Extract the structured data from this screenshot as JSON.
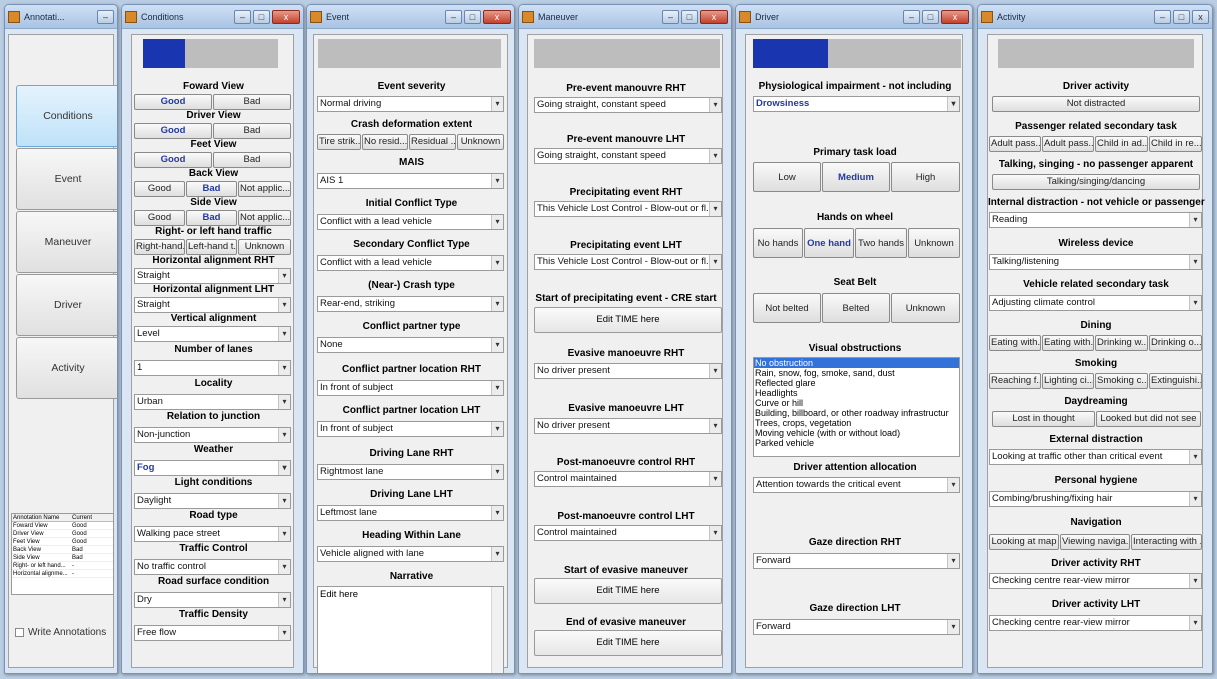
{
  "windows": {
    "annotation": {
      "title": "Annotati..."
    },
    "conditions": {
      "title": "Conditions"
    },
    "event": {
      "title": "Event"
    },
    "maneuver": {
      "title": "Maneuver"
    },
    "driver": {
      "title": "Driver"
    },
    "activity": {
      "title": "Activity"
    }
  },
  "nav": {
    "conditions": "Conditions",
    "event": "Event",
    "maneuver": "Maneuver",
    "driver": "Driver",
    "activity": "Activity"
  },
  "annotation_table": {
    "headers": [
      "Annotation Name",
      "Current"
    ],
    "rows": [
      [
        "Foward View",
        "Good"
      ],
      [
        "Driver View",
        "Good"
      ],
      [
        "Feet View",
        "Good"
      ],
      [
        "Back View",
        "Bad"
      ],
      [
        "Side View",
        "Bad"
      ],
      [
        "Right- or left hand...",
        "-"
      ],
      [
        "Horizontal alignme...",
        "-"
      ]
    ]
  },
  "write_annotations": "Write Annotations",
  "progress": {
    "conditions": 0.31,
    "event": 0,
    "maneuver": 0,
    "driver": 0.36,
    "activity": 0
  },
  "conditions": {
    "foward_view": "Foward View",
    "driver_view": "Driver View",
    "feet_view": "Feet View",
    "back_view": "Back View",
    "side_view": "Side View",
    "good": "Good",
    "bad": "Bad",
    "not_applic": "Not applic...",
    "traffic_hand": "Right- or left hand traffic",
    "right_hand": "Right-hand...",
    "left_hand": "Left-hand t...",
    "unknown": "Unknown",
    "h_align_rht": "Horizontal alignment RHT",
    "h_align_rht_val": "Straight",
    "h_align_lht": "Horizontal alignment LHT",
    "h_align_lht_val": "Straight",
    "v_align": "Vertical alignment",
    "v_align_val": "Level",
    "lanes": "Number of lanes",
    "lanes_val": "1",
    "locality": "Locality",
    "locality_val": "Urban",
    "junction": "Relation to junction",
    "junction_val": "Non-junction",
    "weather": "Weather",
    "weather_val": "Fog",
    "light": "Light conditions",
    "light_val": "Daylight",
    "road_type": "Road type",
    "road_type_val": "Walking pace street",
    "traffic_control": "Traffic Control",
    "traffic_control_val": "No traffic control",
    "surface": "Road surface condition",
    "surface_val": "Dry",
    "density": "Traffic Density",
    "density_val": "Free flow"
  },
  "event": {
    "severity": "Event severity",
    "severity_val": "Normal driving",
    "crash_def": "Crash deformation extent",
    "tire": "Tire strik...",
    "no_resid": "No resid...",
    "residual": "Residual ...",
    "unknown": "Unknown",
    "mais": "MAIS",
    "mais_val": "AIS 1",
    "initial": "Initial Conflict Type",
    "initial_val": "Conflict with a lead vehicle",
    "secondary": "Secondary Conflict Type",
    "secondary_val": "Conflict with a lead vehicle",
    "crash_type": "(Near-) Crash type",
    "crash_type_val": "Rear-end, striking",
    "partner": "Conflict partner type",
    "partner_val": "None",
    "loc_rht": "Conflict partner location RHT",
    "loc_rht_val": "In front of subject",
    "loc_lht": "Conflict partner location LHT",
    "loc_lht_val": "In front of subject",
    "lane_rht": "Driving Lane RHT",
    "lane_rht_val": "Rightmost lane",
    "lane_lht": "Driving Lane LHT",
    "lane_lht_val": "Leftmost lane",
    "heading": "Heading Within Lane",
    "heading_val": "Vehicle aligned with lane",
    "narrative": "Narrative",
    "narrative_val": "Edit here"
  },
  "maneuver": {
    "pre_rht": "Pre-event manouvre RHT",
    "pre_rht_val": "Going straight, constant speed",
    "pre_lht": "Pre-event manouvre LHT",
    "pre_lht_val": "Going straight, constant speed",
    "precip_rht": "Precipitating event RHT",
    "precip_rht_val": "This Vehicle Lost Control - Blow-out or fl...",
    "precip_lht": "Precipitating event LHT",
    "precip_lht_val": "This Vehicle Lost Control - Blow-out or fl...",
    "start_precip": "Start of precipitating event - CRE start",
    "edit_time": "Edit TIME here",
    "evasive_rht": "Evasive manoeuvre RHT",
    "evasive_rht_val": "No driver present",
    "evasive_lht": "Evasive manoeuvre LHT",
    "evasive_lht_val": "No driver present",
    "post_rht": "Post-manoeuvre control RHT",
    "post_rht_val": "Control maintained",
    "post_lht": "Post-manoeuvre control LHT",
    "post_lht_val": "Control maintained",
    "start_evasive": "Start of evasive maneuver",
    "end_evasive": "End of evasive maneuver"
  },
  "driver": {
    "physio": "Physiological impairment - not including",
    "physio_val": "Drowsiness",
    "task_load": "Primary task load",
    "low": "Low",
    "medium": "Medium",
    "high": "High",
    "hands": "Hands on wheel",
    "no_hands": "No hands",
    "one_hand": "One hand",
    "two_hands": "Two hands",
    "unknown": "Unknown",
    "seat_belt": "Seat Belt",
    "not_belted": "Not belted",
    "belted": "Belted",
    "visual": "Visual obstructions",
    "visual_items": [
      "No obstruction",
      "Rain, snow, fog, smoke, sand, dust",
      "Reflected glare",
      "Headlights",
      "Curve or hill",
      "Building, billboard, or other roadway infrastructur",
      "Trees, crops, vegetation",
      "Moving vehicle (with or without load)",
      "Parked vehicle"
    ],
    "attention": "Driver attention allocation",
    "attention_val": "Attention towards the critical event",
    "gaze_rht": "Gaze direction RHT",
    "gaze_rht_val": "Forward",
    "gaze_lht": "Gaze direction LHT",
    "gaze_lht_val": "Forward"
  },
  "activity": {
    "driver_activity": "Driver activity",
    "not_distracted": "Not distracted",
    "passenger": "Passenger related secondary task",
    "p1": "Adult pass...",
    "p2": "Adult pass...",
    "p3": "Child in ad...",
    "p4": "Child in re...",
    "talking": "Talking, singing - no passenger apparent",
    "talking_val": "Talking/singing/dancing",
    "internal": "Internal distraction - not vehicle or passenger",
    "internal_val": "Reading",
    "wireless": "Wireless device",
    "wireless_val": "Talking/listening",
    "vehicle": "Vehicle related secondary task",
    "vehicle_val": "Adjusting climate control",
    "dining": "Dining",
    "d1": "Eating with...",
    "d2": "Eating with...",
    "d3": "Drinking w...",
    "d4": "Drinking o...",
    "smoking": "Smoking",
    "s1": "Reaching f...",
    "s2": "Lighting ci...",
    "s3": "Smoking c...",
    "s4": "Extinguishi...",
    "daydreaming": "Daydreaming",
    "lost": "Lost in thought",
    "looked": "Looked but did not see",
    "external": "External distraction",
    "external_val": "Looking at traffic other than critical event",
    "hygiene": "Personal hygiene",
    "hygiene_val": "Combing/brushing/fixing hair",
    "navigation": "Navigation",
    "n1": "Looking at map",
    "n2": "Viewing naviga...",
    "n3": "Interacting with ...",
    "act_rht": "Driver activity RHT",
    "act_rht_val": "Checking centre rear-view mirror",
    "act_lht": "Driver activity LHT",
    "act_lht_val": "Checking centre rear-view mirror"
  }
}
